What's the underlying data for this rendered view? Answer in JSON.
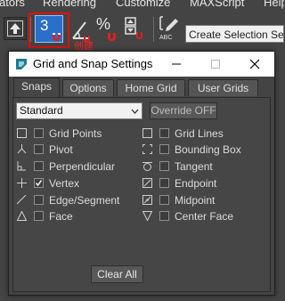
{
  "menubar": {
    "items": [
      {
        "label": "ators"
      },
      {
        "label": "Rendering"
      },
      {
        "label": "Customize"
      },
      {
        "label": "MAXScript"
      },
      {
        "label": "Help"
      }
    ]
  },
  "toolbar": {
    "snap_toggle_label": "3",
    "percent_snap_label": "%",
    "abc_label": "ABC",
    "selection_set_value": "Create Selection Se",
    "annotation_caption": "创建",
    "annotation_color": "#e01010"
  },
  "dialog": {
    "title": "Grid and Snap Settings",
    "tabs": [
      {
        "label": "Snaps",
        "active": true
      },
      {
        "label": "Options",
        "active": false
      },
      {
        "label": "Home Grid",
        "active": false
      },
      {
        "label": "User Grids",
        "active": false
      }
    ],
    "dropdown_value": "Standard",
    "override_label": "Override OFF",
    "options_left": [
      {
        "label": "Grid Points",
        "checked": false,
        "icon": "grid-points-icon"
      },
      {
        "label": "Pivot",
        "checked": false,
        "icon": "pivot-icon"
      },
      {
        "label": "Perpendicular",
        "checked": false,
        "icon": "perpendicular-icon"
      },
      {
        "label": "Vertex",
        "checked": true,
        "icon": "vertex-icon"
      },
      {
        "label": "Edge/Segment",
        "checked": false,
        "icon": "edge-segment-icon"
      },
      {
        "label": "Face",
        "checked": false,
        "icon": "face-icon"
      }
    ],
    "options_right": [
      {
        "label": "Grid Lines",
        "checked": false,
        "icon": "grid-lines-icon"
      },
      {
        "label": "Bounding Box",
        "checked": false,
        "icon": "bounding-box-icon"
      },
      {
        "label": "Tangent",
        "checked": false,
        "icon": "tangent-icon"
      },
      {
        "label": "Endpoint",
        "checked": false,
        "icon": "endpoint-icon"
      },
      {
        "label": "Midpoint",
        "checked": false,
        "icon": "midpoint-icon"
      },
      {
        "label": "Center Face",
        "checked": false,
        "icon": "center-face-icon"
      }
    ],
    "clear_all_label": "Clear All"
  }
}
